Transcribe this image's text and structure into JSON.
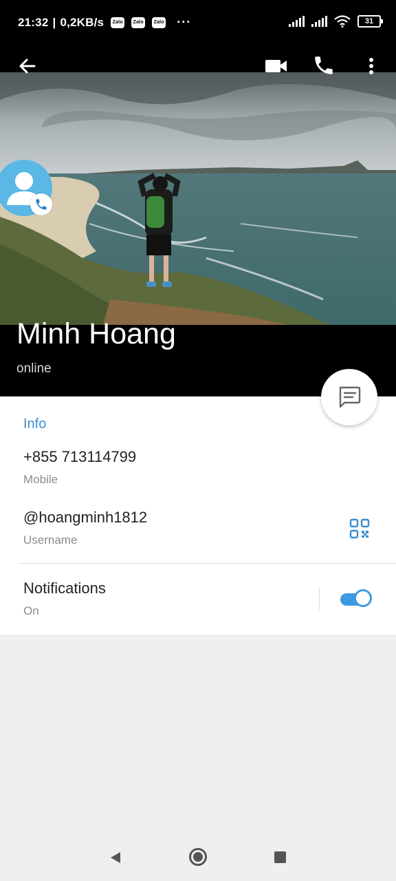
{
  "status_bar": {
    "time": "21:32",
    "speed": "0,2KB/s",
    "app_badges": [
      "Zalo",
      "Zalo",
      "Zalo"
    ],
    "more_dots": "···",
    "battery": "31"
  },
  "toolbar": {
    "icons": [
      "back-arrow-icon",
      "video-call-icon",
      "phone-call-icon",
      "more-vert-icon"
    ]
  },
  "profile": {
    "name": "Minh Hoang",
    "status": "online"
  },
  "info": {
    "section_title": "Info",
    "phone": "+855 713114799",
    "phone_label": "Mobile",
    "username": "@hoangminh1812",
    "username_label": "Username",
    "notifications": "Notifications",
    "notifications_state": "On",
    "notifications_enabled": true
  },
  "colors": {
    "accent": "#3a8ed0",
    "toggle": "#3d9ae0",
    "avatar_bg": "#5ab7e6"
  }
}
